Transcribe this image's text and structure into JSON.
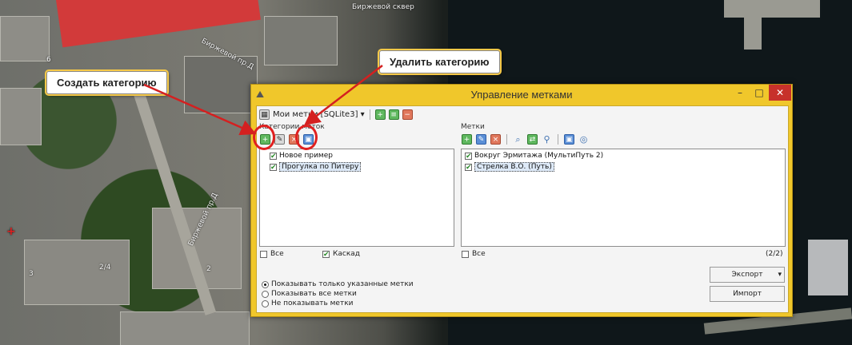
{
  "map": {
    "labels": {
      "park": "Биржевой сквер",
      "street1": "Биржевой пр.Д",
      "street2": "Биржевой пр.Д",
      "num1": "2/4",
      "num2": "3",
      "num3": "2",
      "num4": "6"
    }
  },
  "callouts": {
    "create": "Создать категорию",
    "delete": "Удалить категорию"
  },
  "window": {
    "title": "Управление метками",
    "minimize_glyph": "–",
    "maximize_glyph": "□",
    "close_glyph": "✕",
    "my_marks": "Мои метки [SQLite3] ▾",
    "categories_label": "Категории меток",
    "marks_label": "Метки",
    "categories": [
      {
        "label": "Новое пример",
        "checked": true
      },
      {
        "label": "Прогулка по Питеру",
        "checked": true,
        "selected": true
      }
    ],
    "marks": [
      {
        "label": "Вокруг Эрмитажа (МультиПуть 2)",
        "checked": true
      },
      {
        "label": "Стрелка В.О. (Путь)",
        "checked": true,
        "selected": true
      }
    ],
    "left_all": "Все",
    "cascade": "Каскад",
    "right_all": "Все",
    "count": "(2/2)",
    "radios": [
      {
        "label": "Показывать только указанные метки",
        "selected": true
      },
      {
        "label": "Показывать все метки",
        "selected": false
      },
      {
        "label": "Не показывать метки",
        "selected": false
      }
    ],
    "export": "Экспорт",
    "import": "Импорт"
  }
}
